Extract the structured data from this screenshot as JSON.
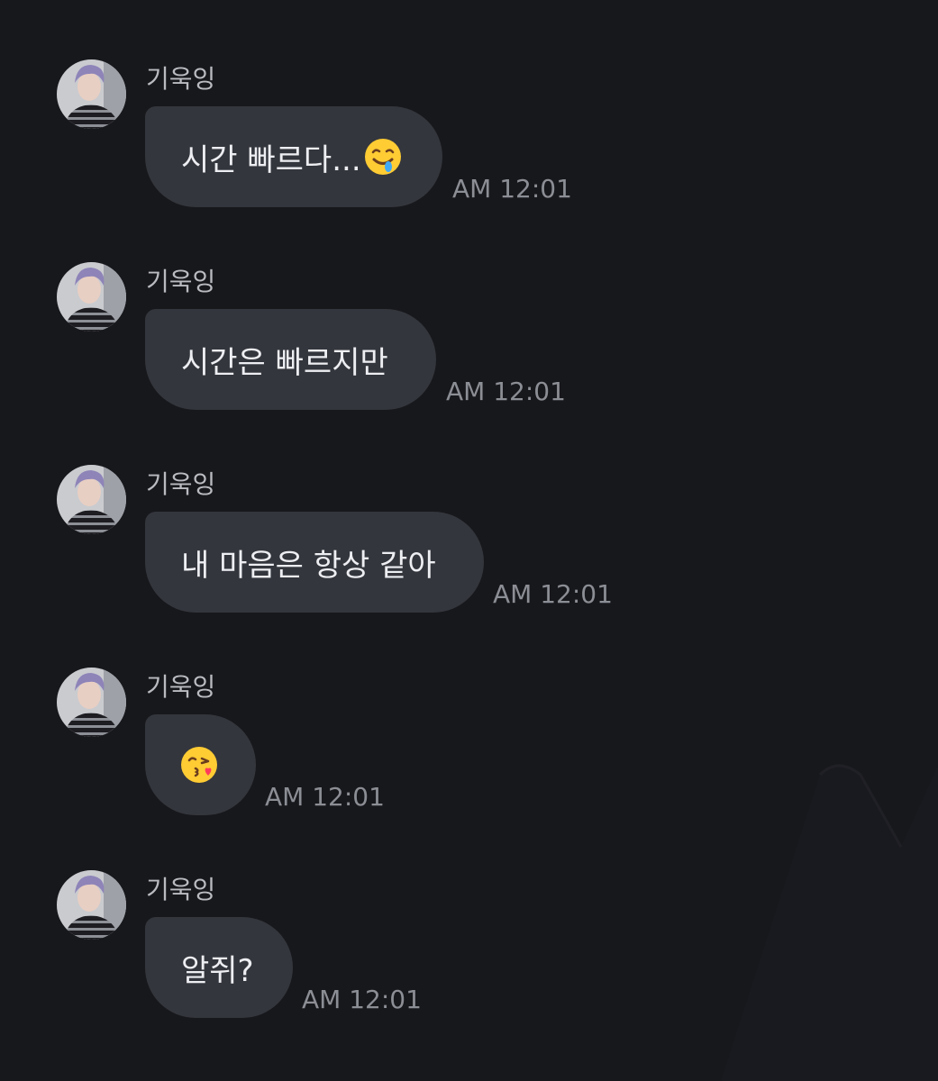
{
  "messages": [
    {
      "sender": "기욱잉",
      "text": "시간 빠르다...",
      "emoji": "drooling-face-emoji",
      "time": "AM 12:01"
    },
    {
      "sender": "기욱잉",
      "text": "시간은 빠르지만",
      "emoji": null,
      "time": "AM 12:01"
    },
    {
      "sender": "기욱잉",
      "text": "내 마음은 항상 같아",
      "emoji": null,
      "time": "AM 12:01"
    },
    {
      "sender": "기욱잉",
      "text": "",
      "emoji": "face-blowing-kiss-emoji",
      "time": "AM 12:01"
    },
    {
      "sender": "기욱잉",
      "text": "알쥐?",
      "emoji": null,
      "time": "AM 12:01"
    }
  ],
  "colors": {
    "background": "#17181c",
    "bubble": "#34363d",
    "text": "#eceef2",
    "sender": "#b9bbc1",
    "time": "#8c8e95"
  }
}
